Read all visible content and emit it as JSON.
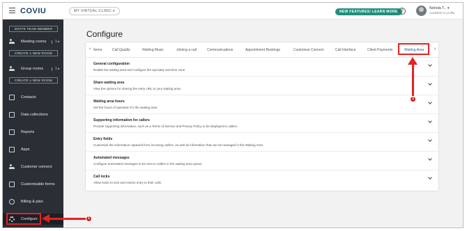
{
  "header": {
    "logo": "COVIU",
    "clinic_selector": "MY VIRTUAL CLINIC  ▾",
    "new_features": "NEW FEATURES! LEARN MORE",
    "help": "?",
    "user_name": "Nichola T...  ▾",
    "user_sub": "Available to profile"
  },
  "sidebar": {
    "invite_button": "INVITE TEAM MEMBER",
    "meeting_rooms": "Meeting rooms",
    "meeting_rooms_count": "1  ▸",
    "create_room_1": "CREATE A NEW ROOM",
    "group_rooms": "Group rooms",
    "group_rooms_count": "1  ▸",
    "create_room_2": "CREATE A NEW ROOM",
    "items": [
      {
        "label": "Contacts"
      },
      {
        "label": "Data collections"
      },
      {
        "label": "Reports"
      },
      {
        "label": "Apps"
      },
      {
        "label": "Customer connect"
      },
      {
        "label": "Customisable forms"
      },
      {
        "label": "Billing & plan"
      },
      {
        "label": "Configure"
      }
    ]
  },
  "main": {
    "title": "Configure",
    "tabs": [
      {
        "label": "Items"
      },
      {
        "label": "Call Quality"
      },
      {
        "label": "Waiting Music"
      },
      {
        "label": "Joining a call"
      },
      {
        "label": "Communications"
      },
      {
        "label": "Appointment Bookings"
      },
      {
        "label": "Customise Connect"
      },
      {
        "label": "Call Interface"
      },
      {
        "label": "Client Payments"
      },
      {
        "label": "Waiting Area"
      }
    ],
    "sections": [
      {
        "title": "General configuration",
        "desc": "Enable the waiting area and configure the specialty and time zone"
      },
      {
        "title": "Share waiting area",
        "desc": "View the options for sharing the entry URL to your waiting area"
      },
      {
        "title": "Waiting area hours",
        "desc": "Set the hours of operation for the waiting area"
      },
      {
        "title": "Supporting information for callers",
        "desc": "Provide supporting information, such as a Terms of Service and Privacy Policy to be displayed to callers"
      },
      {
        "title": "Entry fields",
        "desc": "Customise the information captured from incoming callers, as well as information that can be managed in the Waiting Area"
      },
      {
        "title": "Automated messages",
        "desc": "Configure automated messages to be sent to callers in the waiting area queue"
      },
      {
        "title": "Call locks",
        "desc": "Allow hosts to lock and restrict entry to their calls"
      }
    ]
  },
  "annotations": {
    "step1": "1",
    "step2": "2",
    "color": "#e52222"
  }
}
